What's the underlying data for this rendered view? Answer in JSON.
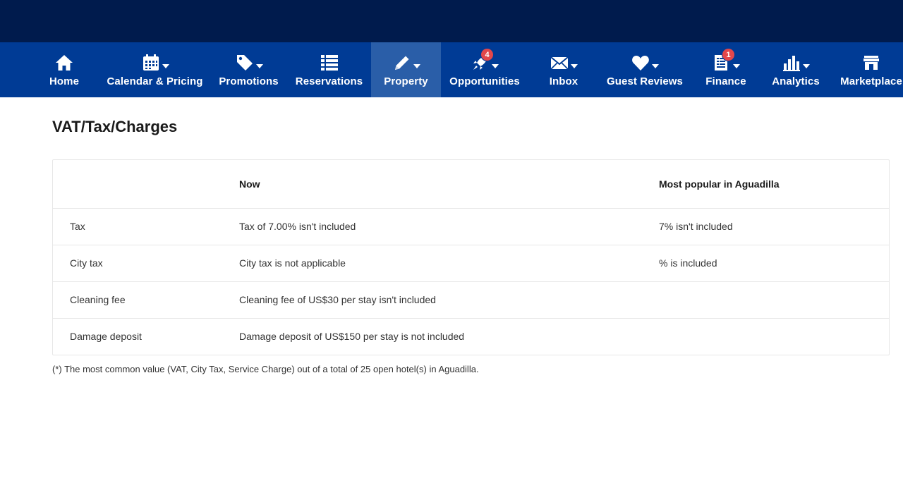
{
  "nav": {
    "items": [
      {
        "label": "Home",
        "icon": "house-icon",
        "caret": false,
        "badge": ""
      },
      {
        "label": "Calendar & Pricing",
        "icon": "calendar-icon",
        "caret": true,
        "badge": ""
      },
      {
        "label": "Promotions",
        "icon": "tag-icon",
        "caret": true,
        "badge": ""
      },
      {
        "label": "Reservations",
        "icon": "list-icon",
        "caret": false,
        "badge": ""
      },
      {
        "label": "Property",
        "icon": "pencil-icon",
        "caret": true,
        "badge": "",
        "active": true
      },
      {
        "label": "Opportunities",
        "icon": "rocket-icon",
        "caret": true,
        "badge": "4"
      },
      {
        "label": "Inbox",
        "icon": "envelope-icon",
        "caret": true,
        "badge": ""
      },
      {
        "label": "Guest Reviews",
        "icon": "heart-icon",
        "caret": true,
        "badge": ""
      },
      {
        "label": "Finance",
        "icon": "invoice-icon",
        "caret": true,
        "badge": "1"
      },
      {
        "label": "Analytics",
        "icon": "bar-chart-icon",
        "caret": true,
        "badge": ""
      },
      {
        "label": "Marketplace",
        "icon": "store-icon",
        "caret": false,
        "badge": ""
      }
    ]
  },
  "page": {
    "title": "VAT/Tax/Charges"
  },
  "table": {
    "headers": [
      "",
      "Now",
      "Most popular in Aguadilla"
    ],
    "rows": [
      [
        "Tax",
        "Tax of 7.00% isn't included",
        "7% isn't included"
      ],
      [
        "City tax",
        "City tax is not applicable",
        "% is included"
      ],
      [
        "Cleaning fee",
        "Cleaning fee of US$30 per stay isn't included",
        ""
      ],
      [
        "Damage deposit",
        "Damage deposit of US$150 per stay is not included",
        ""
      ]
    ]
  },
  "footnote": "(*) The most common value (VAT, City Tax, Service Charge) out of a total of 25 open hotel(s) in Aguadilla.",
  "colors": {
    "topbar": "#001b4d",
    "navbar": "#003b95",
    "active": "#2a5ea8",
    "badge": "#e2474b"
  }
}
